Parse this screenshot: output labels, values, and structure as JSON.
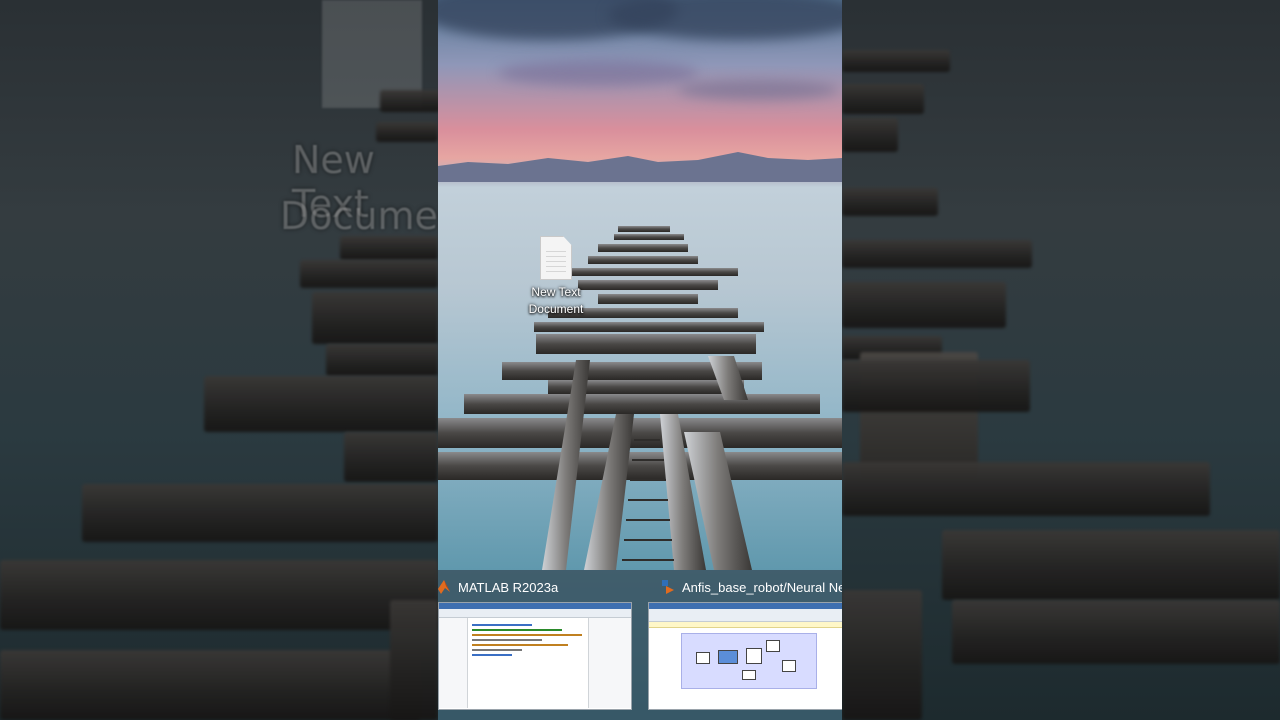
{
  "desktop": {
    "icon_label_line1": "New Text",
    "icon_label_line2": "Document"
  },
  "background_echo": {
    "text_line1": "New Text",
    "text_line2": "Documen"
  },
  "taskbar_previews": [
    {
      "title": "MATLAB R2023a",
      "icon": "matlab-icon"
    },
    {
      "title": "Anfis_base_robot/Neural Ne",
      "icon": "simulink-icon"
    }
  ],
  "colors": {
    "matlab_orange": "#e16b1f",
    "simulink_blue": "#2f6fb8",
    "sim_canvas": "#d8dcff"
  }
}
